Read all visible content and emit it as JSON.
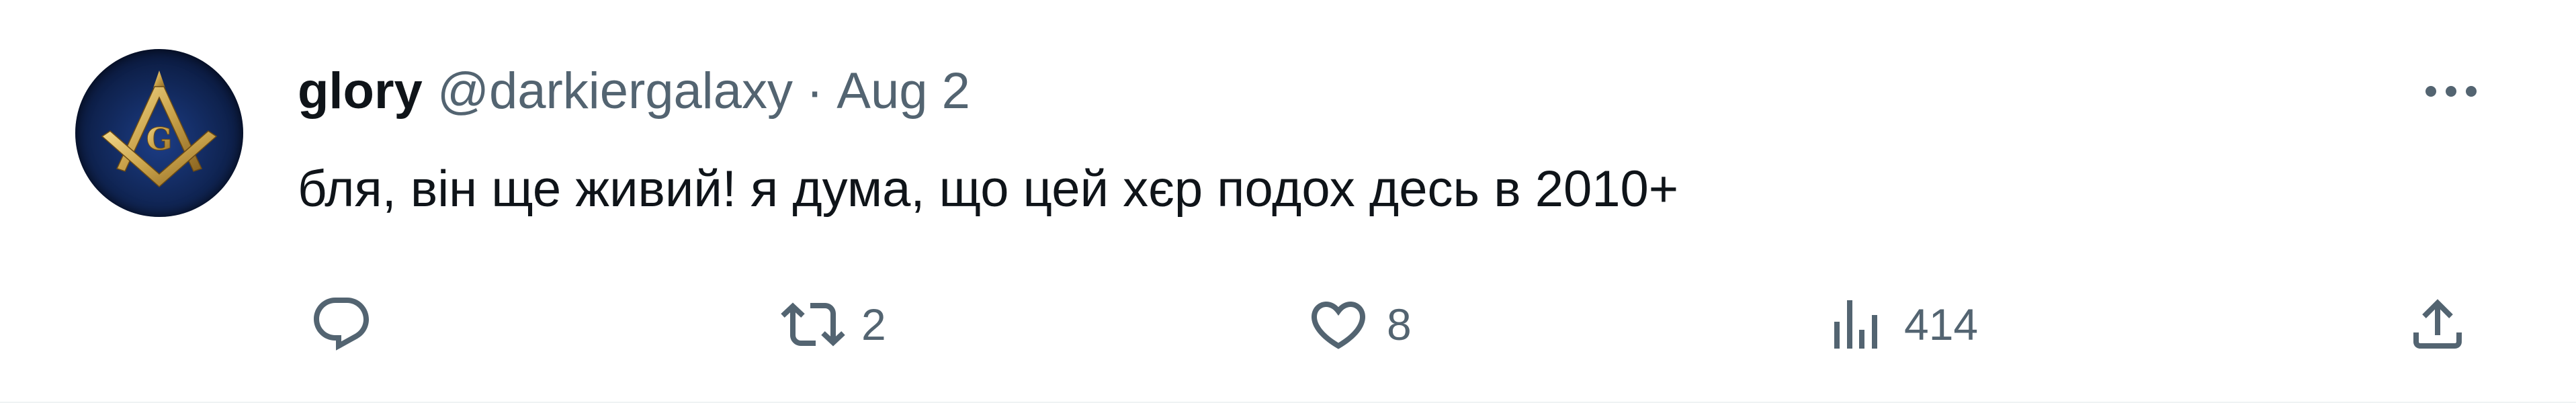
{
  "tweet": {
    "author": {
      "display_name": "glory",
      "handle": "@darkiergalaxy",
      "avatar_icon": "masonic-square-compass-icon"
    },
    "separator": "·",
    "date": "Aug 2",
    "text": "бля, він ще живий! я дума, що цей хєр подох десь в 2010+",
    "more_icon": "more-horizontal-icon",
    "actions": {
      "reply": {
        "icon": "reply-icon",
        "count": ""
      },
      "retweet": {
        "icon": "retweet-icon",
        "count": "2"
      },
      "like": {
        "icon": "heart-icon",
        "count": "8"
      },
      "views": {
        "icon": "views-bar-chart-icon",
        "count": "414"
      },
      "share": {
        "icon": "share-icon"
      }
    }
  },
  "colors": {
    "text_primary": "#0f1419",
    "text_secondary": "#536471",
    "avatar_gold": "#c9a24a",
    "avatar_blue": "#1c3d86"
  }
}
